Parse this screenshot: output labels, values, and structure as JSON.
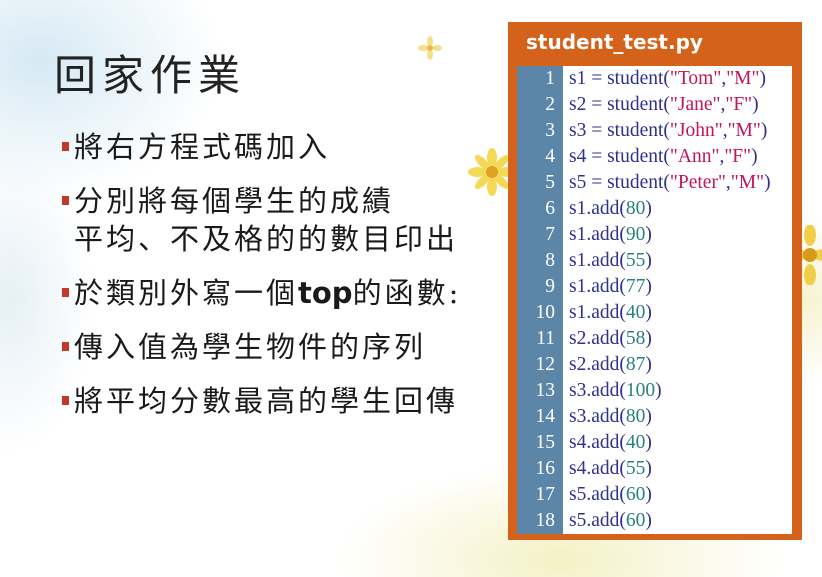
{
  "slide": {
    "title": "回家作業",
    "bullets": [
      {
        "text": "將右方程式碼加入"
      },
      {
        "text": "分別將每個學生的成績",
        "text2": "平均、不及格的的數目印出"
      },
      {
        "pre": "於類別外寫一個",
        "bold": "top",
        "post": "的函數:"
      },
      {
        "text": "傳入值為學生物件的序列"
      },
      {
        "text": "將平均分數最高的學生回傳"
      }
    ]
  },
  "code_panel": {
    "filename": "student_test.py",
    "lines": [
      {
        "n": "1",
        "pre": "s1 = student(",
        "s1": "\"Tom\"",
        "mid": ",",
        "s2": "\"M\"",
        "post": ")"
      },
      {
        "n": "2",
        "pre": "s2 = student(",
        "s1": "\"Jane\"",
        "mid": ",",
        "s2": "\"F\"",
        "post": ")"
      },
      {
        "n": "3",
        "pre": "s3 = student(",
        "s1": "\"John\"",
        "mid": ",",
        "s2": "\"M\"",
        "post": ")"
      },
      {
        "n": "4",
        "pre": "s4 = student(",
        "s1": "\"Ann\"",
        "mid": ",",
        "s2": "\"F\"",
        "post": ")"
      },
      {
        "n": "5",
        "pre": "s5 = student(",
        "s1": "\"Peter\"",
        "mid": ",",
        "s2": "\"M\"",
        "post": ")"
      },
      {
        "n": "6",
        "pre": "s1.add(",
        "num": "80",
        "post": ")"
      },
      {
        "n": "7",
        "pre": "s1.add(",
        "num": "90",
        "post": ")"
      },
      {
        "n": "8",
        "pre": "s1.add(",
        "num": "55",
        "post": ")"
      },
      {
        "n": "9",
        "pre": "s1.add(",
        "num": "77",
        "post": ")"
      },
      {
        "n": "10",
        "pre": "s1.add(",
        "num": "40",
        "post": ")"
      },
      {
        "n": "11",
        "pre": "s2.add(",
        "num": "58",
        "post": ")"
      },
      {
        "n": "12",
        "pre": "s2.add(",
        "num": "87",
        "post": ")"
      },
      {
        "n": "13",
        "pre": "s3.add(",
        "num": "100",
        "post": ")"
      },
      {
        "n": "14",
        "pre": "s3.add(",
        "num": "80",
        "post": ")"
      },
      {
        "n": "15",
        "pre": "s4.add(",
        "num": "40",
        "post": ")"
      },
      {
        "n": "16",
        "pre": "s4.add(",
        "num": "55",
        "post": ")"
      },
      {
        "n": "17",
        "pre": "s5.add(",
        "num": "60",
        "post": ")"
      },
      {
        "n": "18",
        "pre": "s5.add(",
        "num": "60",
        "post": ")"
      }
    ]
  },
  "colors": {
    "panel": "#d4621a",
    "gutter": "#5b86a7",
    "string": "#c0145b",
    "number": "#2a8080",
    "bullet_mark": "#c0392b"
  }
}
